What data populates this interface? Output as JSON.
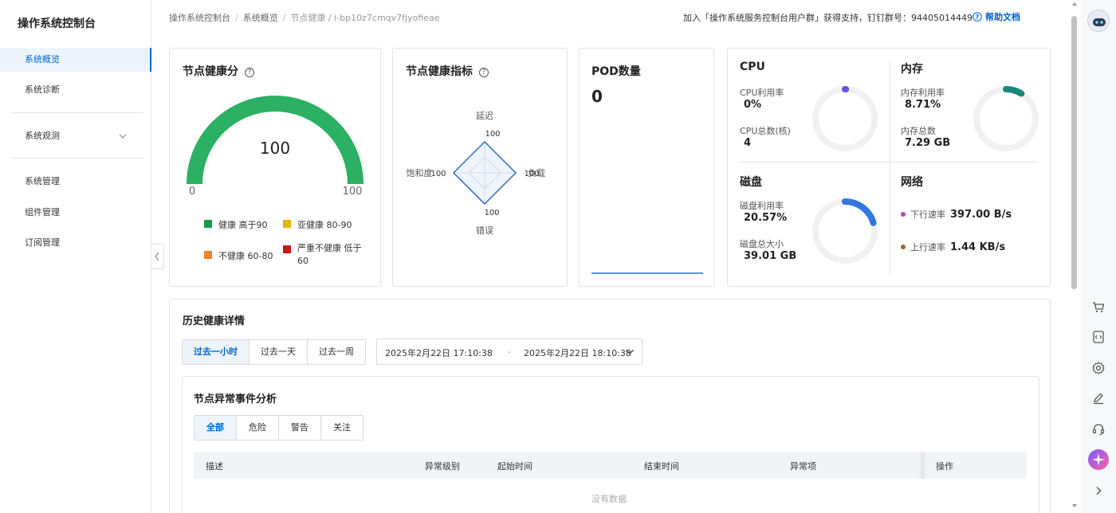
{
  "sidebar": {
    "title": "操作系统控制台",
    "items": [
      {
        "label": "系统概览"
      },
      {
        "label": "系统诊断"
      },
      {
        "label": "系统观测"
      },
      {
        "label": "系统管理"
      },
      {
        "label": "组件管理"
      },
      {
        "label": "订阅管理"
      }
    ]
  },
  "header": {
    "breadcrumb": [
      "操作系统控制台",
      "系统概览",
      "节点健康 / i-bp10z7cmqv7fjyofieae"
    ],
    "support_text": "加入「操作系统服务控制台用户群」获得支持，钉钉群号：94405014449",
    "help_label": "帮助文档"
  },
  "health_score": {
    "title": "节点健康分",
    "value": "100",
    "min_label": "0",
    "max_label": "100",
    "level": 1.0,
    "legend": [
      {
        "label": "健康 高于90",
        "color": "#1a9a50"
      },
      {
        "label": "亚健康 80-90",
        "color": "#e5b500"
      },
      {
        "label": "不健康 60-80",
        "color": "#f0822a"
      },
      {
        "label": "严重不健康 低于60",
        "color": "#d0121b"
      }
    ],
    "arc_color": "#2bb064"
  },
  "health_indicators": {
    "title": "节点健康指标",
    "axes": [
      {
        "name": "延迟",
        "value": "100"
      },
      {
        "name": "负载",
        "value": "100"
      },
      {
        "name": "错误",
        "value": "100"
      },
      {
        "name": "饱和度",
        "value": "100"
      }
    ]
  },
  "pod": {
    "title": "POD数量",
    "value": "0"
  },
  "cpu": {
    "title": "CPU",
    "usage_label": "CPU利用率",
    "usage_value": "0%",
    "usage_fraction": 0.0,
    "total_label": "CPU总数(核)",
    "total_value": "4",
    "color": "#6b4fe0"
  },
  "memory": {
    "title": "内存",
    "usage_label": "内存利用率",
    "usage_value": "8.71%",
    "usage_fraction": 0.0871,
    "total_label": "内存总数",
    "total_value": "7.29 GB",
    "color": "#16897a"
  },
  "disk": {
    "title": "磁盘",
    "usage_label": "磁盘利用率",
    "usage_value": "20.57%",
    "usage_fraction": 0.2057,
    "total_label": "磁盘总大小",
    "total_value": "39.01 GB",
    "color": "#3377dd"
  },
  "network": {
    "title": "网络",
    "down_label": "下行速率",
    "down_value": "397.00 B/s",
    "down_color": "#b544b8",
    "up_label": "上行速率",
    "up_value": "1.44 KB/s",
    "up_color": "#a0622a"
  },
  "history": {
    "title": "历史健康详情",
    "ranges": [
      "过去一小时",
      "过去一天",
      "过去一周"
    ],
    "active_range": 0,
    "date_start": "2025年2月22日 17:10:38",
    "date_sep": "-",
    "date_end": "2025年2月22日 18:10:38"
  },
  "events": {
    "title": "节点异常事件分析",
    "filters": [
      "全部",
      "危险",
      "警告",
      "关注"
    ],
    "active_filter": 0,
    "columns": [
      "描述",
      "异常级别",
      "起始时间",
      "结束时间",
      "异常项",
      "操作"
    ],
    "empty_text": "没有数据"
  }
}
